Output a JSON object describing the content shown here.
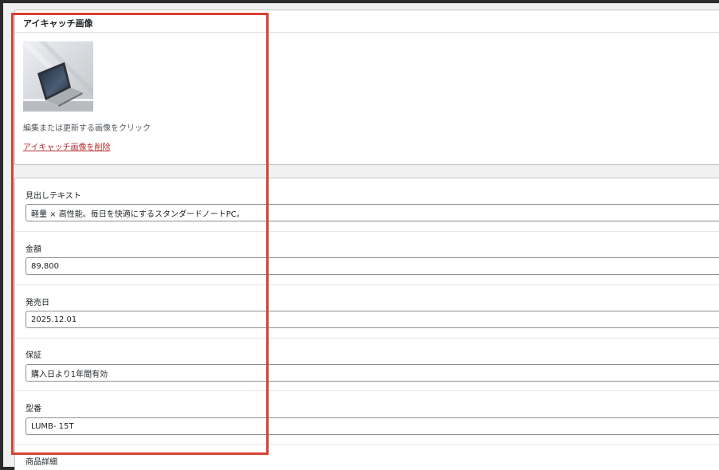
{
  "featured_image": {
    "title": "アイキャッチ画像",
    "help_text": "編集または更新する画像をクリック",
    "remove_link": "アイキャッチ画像を削除"
  },
  "fields": [
    {
      "label": "見出しテキスト",
      "value": "軽量 × 高性能。毎日を快適にするスタンダードノートPC。"
    },
    {
      "label": "金額",
      "value": "89,800"
    },
    {
      "label": "発売日",
      "value": "2025.12.01"
    },
    {
      "label": "保証",
      "value": "購入日より1年間有効"
    },
    {
      "label": "型番",
      "value": "LUMB- 15T"
    }
  ],
  "next_field_label": "商品詳細",
  "colors": {
    "highlight": "#d8412f",
    "link": "#b32d2e"
  }
}
